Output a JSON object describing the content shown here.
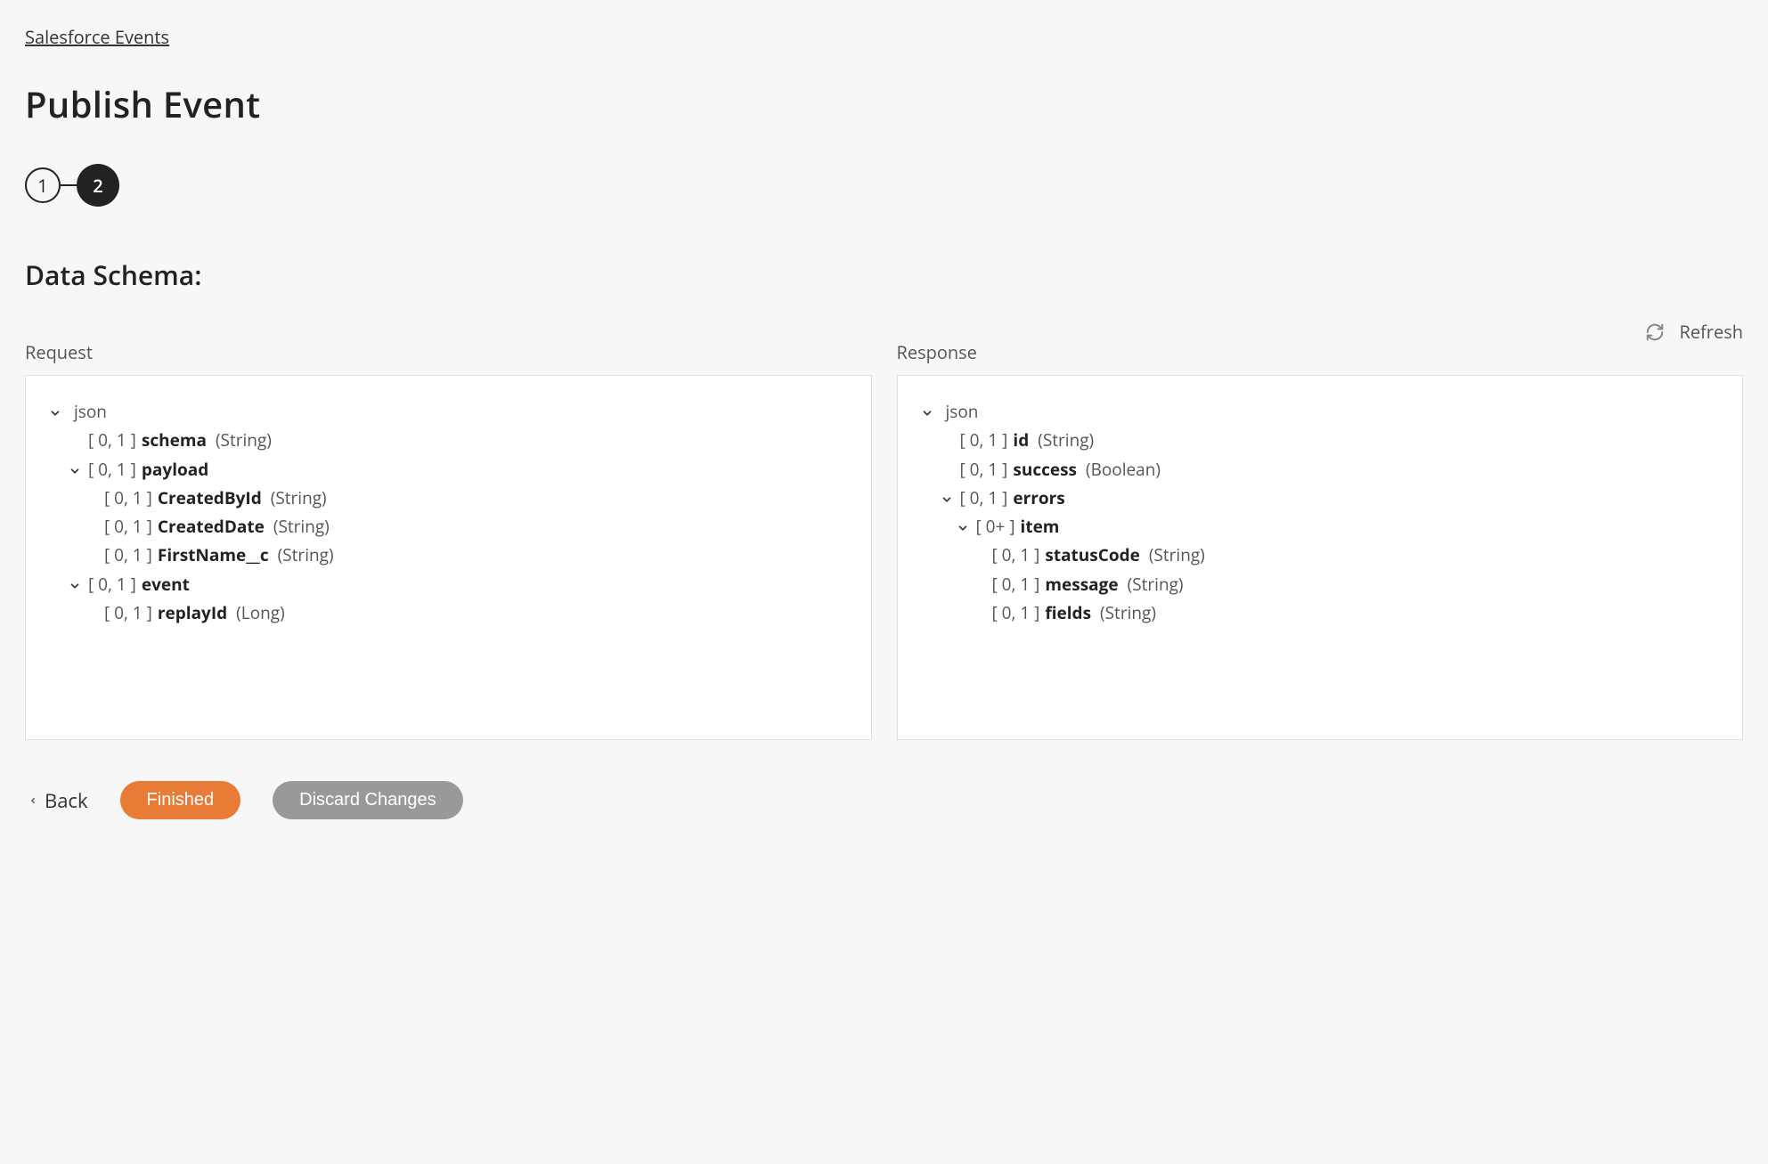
{
  "breadcrumb": "Salesforce Events",
  "title": "Publish Event",
  "stepper": {
    "step1": "1",
    "step2": "2"
  },
  "section_label": "Data Schema:",
  "refresh_label": "Refresh",
  "request_label": "Request",
  "response_label": "Response",
  "request_tree": {
    "root": "json",
    "schema": {
      "card": "[ 0, 1 ]",
      "name": "schema",
      "type": "(String)"
    },
    "payload": {
      "card": "[ 0, 1 ]",
      "name": "payload"
    },
    "payload_children": {
      "createdById": {
        "card": "[ 0, 1 ]",
        "name": "CreatedById",
        "type": "(String)"
      },
      "createdDate": {
        "card": "[ 0, 1 ]",
        "name": "CreatedDate",
        "type": "(String)"
      },
      "firstName": {
        "card": "[ 0, 1 ]",
        "name": "FirstName__c",
        "type": "(String)"
      }
    },
    "event": {
      "card": "[ 0, 1 ]",
      "name": "event"
    },
    "event_children": {
      "replayId": {
        "card": "[ 0, 1 ]",
        "name": "replayId",
        "type": "(Long)"
      }
    }
  },
  "response_tree": {
    "root": "json",
    "id": {
      "card": "[ 0, 1 ]",
      "name": "id",
      "type": "(String)"
    },
    "success": {
      "card": "[ 0, 1 ]",
      "name": "success",
      "type": "(Boolean)"
    },
    "errors": {
      "card": "[ 0, 1 ]",
      "name": "errors"
    },
    "item": {
      "card": "[ 0+ ]",
      "name": "item"
    },
    "item_children": {
      "statusCode": {
        "card": "[ 0, 1 ]",
        "name": "statusCode",
        "type": "(String)"
      },
      "message": {
        "card": "[ 0, 1 ]",
        "name": "message",
        "type": "(String)"
      },
      "fields": {
        "card": "[ 0, 1 ]",
        "name": "fields",
        "type": "(String)"
      }
    }
  },
  "footer": {
    "back": "Back",
    "finished": "Finished",
    "discard": "Discard Changes"
  }
}
